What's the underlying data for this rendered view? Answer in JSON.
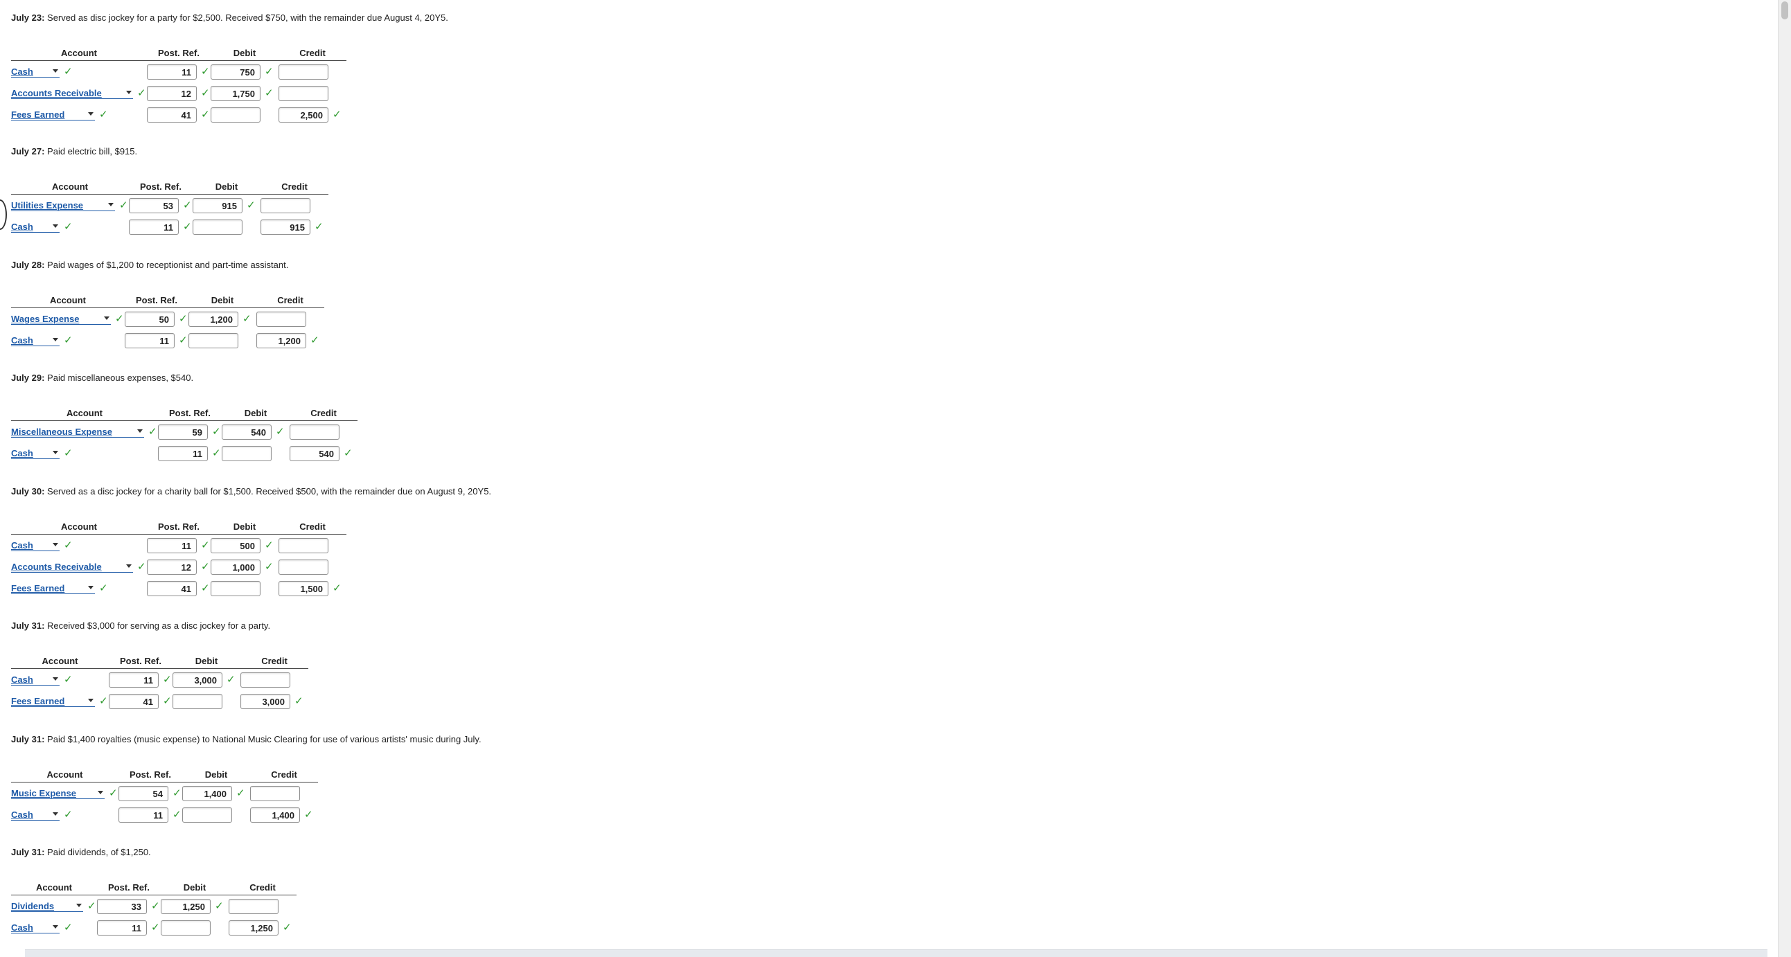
{
  "entries": [
    {
      "date": "July 23:",
      "description": "Served as disc jockey for a party for $2,500. Received $750, with the remainder due August 4, 20Y5.",
      "headers": {
        "account": "Account",
        "post_ref": "Post. Ref.",
        "debit": "Debit",
        "credit": "Credit"
      },
      "rows": [
        {
          "account": "Cash",
          "post_ref": "11",
          "debit": "750",
          "credit": ""
        },
        {
          "account": "Accounts Receivable",
          "post_ref": "12",
          "debit": "1,750",
          "credit": ""
        },
        {
          "account": "Fees Earned",
          "post_ref": "41",
          "debit": "",
          "credit": "2,500"
        }
      ]
    },
    {
      "date": "July 27:",
      "description": "Paid electric bill, $915.",
      "headers": {
        "account": "Account",
        "post_ref": "Post. Ref.",
        "debit": "Debit",
        "credit": "Credit"
      },
      "rows": [
        {
          "account": "Utilities Expense",
          "post_ref": "53",
          "debit": "915",
          "credit": ""
        },
        {
          "account": "Cash",
          "post_ref": "11",
          "debit": "",
          "credit": "915"
        }
      ]
    },
    {
      "date": "July 28:",
      "description": "Paid wages of $1,200 to receptionist and part-time assistant.",
      "headers": {
        "account": "Account",
        "post_ref": "Post. Ref.",
        "debit": "Debit",
        "credit": "Credit"
      },
      "rows": [
        {
          "account": "Wages Expense",
          "post_ref": "50",
          "debit": "1,200",
          "credit": ""
        },
        {
          "account": "Cash",
          "post_ref": "11",
          "debit": "",
          "credit": "1,200"
        }
      ]
    },
    {
      "date": "July 29:",
      "description": "Paid miscellaneous expenses, $540.",
      "headers": {
        "account": "Account",
        "post_ref": "Post. Ref.",
        "debit": "Debit",
        "credit": "Credit"
      },
      "rows": [
        {
          "account": "Miscellaneous Expense",
          "post_ref": "59",
          "debit": "540",
          "credit": ""
        },
        {
          "account": "Cash",
          "post_ref": "11",
          "debit": "",
          "credit": "540"
        }
      ]
    },
    {
      "date": "July 30:",
      "description": "Served as a disc jockey for a charity ball for $1,500. Received $500, with the remainder due on August 9, 20Y5.",
      "headers": {
        "account": "Account",
        "post_ref": "Post. Ref.",
        "debit": "Debit",
        "credit": "Credit"
      },
      "rows": [
        {
          "account": "Cash",
          "post_ref": "11",
          "debit": "500",
          "credit": ""
        },
        {
          "account": "Accounts Receivable",
          "post_ref": "12",
          "debit": "1,000",
          "credit": ""
        },
        {
          "account": "Fees Earned",
          "post_ref": "41",
          "debit": "",
          "credit": "1,500"
        }
      ]
    },
    {
      "date": "July 31:",
      "description": "Received $3,000 for serving as a disc jockey for a party.",
      "headers": {
        "account": "Account",
        "post_ref": "Post. Ref.",
        "debit": "Debit",
        "credit": "Credit"
      },
      "rows": [
        {
          "account": "Cash",
          "post_ref": "11",
          "debit": "3,000",
          "credit": ""
        },
        {
          "account": "Fees Earned",
          "post_ref": "41",
          "debit": "",
          "credit": "3,000"
        }
      ]
    },
    {
      "date": "July 31:",
      "description": "Paid $1,400 royalties (music expense) to National Music Clearing for use of various artists' music during July.",
      "headers": {
        "account": "Account",
        "post_ref": "Post. Ref.",
        "debit": "Debit",
        "credit": "Credit"
      },
      "rows": [
        {
          "account": "Music Expense",
          "post_ref": "54",
          "debit": "1,400",
          "credit": ""
        },
        {
          "account": "Cash",
          "post_ref": "11",
          "debit": "",
          "credit": "1,400"
        }
      ]
    },
    {
      "date": "July 31:",
      "description": "Paid dividends, of $1,250.",
      "headers": {
        "account": "Account",
        "post_ref": "Post. Ref.",
        "debit": "Debit",
        "credit": "Credit"
      },
      "rows": [
        {
          "account": "Dividends",
          "post_ref": "33",
          "debit": "1,250",
          "credit": ""
        },
        {
          "account": "Cash",
          "post_ref": "11",
          "debit": "",
          "credit": "1,250"
        }
      ]
    }
  ],
  "icons": {
    "check": "✓",
    "dropdown": "chevron-down-icon",
    "check_name": "check-icon"
  },
  "colors": {
    "link": "#1f5ba8",
    "check": "#2e9a2e"
  }
}
